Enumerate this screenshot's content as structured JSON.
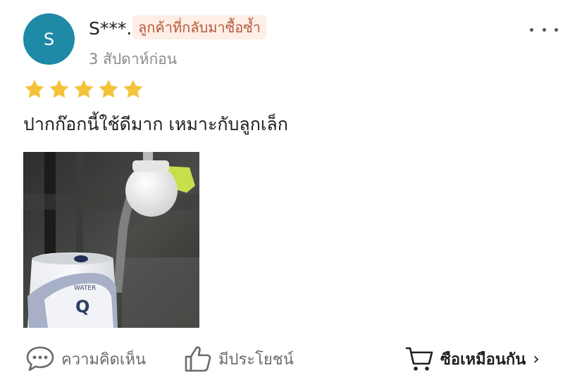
{
  "review": {
    "avatar_letter": "S",
    "username": "S***.",
    "badge": "ลูกค้าที่กลับมาซื้อซ้ำ",
    "time": "3 สัปดาห์ก่อน",
    "rating": 5,
    "text": "ปากก๊อกนี้ใช้ดีมาก เหมาะกับลูกเล็ก",
    "photo": {
      "mug_brand": "WATER",
      "mug_logo": "Q"
    }
  },
  "actions": {
    "comment_label": "ความคิดเห็น",
    "helpful_label": "มีประโยชน์",
    "buy_label": "ซือเหมือนกัน",
    "buy_chevron": "›"
  },
  "colors": {
    "avatar": "#1e8aa6",
    "star": "#f5c33b",
    "badge_bg": "#fdeee6",
    "badge_text": "#b45a3c"
  },
  "icons": [
    "more-icon",
    "star-icon",
    "comment-icon",
    "thumbs-up-icon",
    "cart-icon",
    "chevron-right-icon"
  ]
}
